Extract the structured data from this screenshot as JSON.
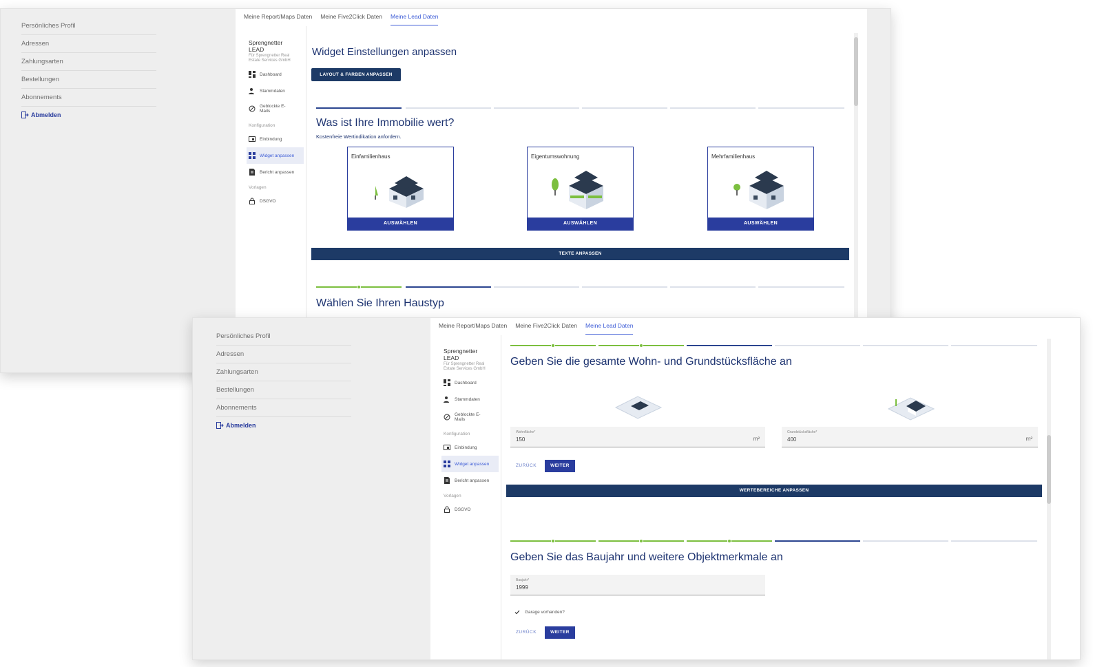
{
  "outer_sidebar": {
    "items": [
      "Persönliches Profil",
      "Adressen",
      "Zahlungsarten",
      "Bestellungen",
      "Abonnements"
    ],
    "logout": "Abmelden"
  },
  "tabs": [
    "Meine Report/Maps Daten",
    "Meine Five2Click Daten",
    "Meine Lead Daten"
  ],
  "inner_nav": {
    "brand": "Sprengnetter LEAD",
    "brand_sub": "Für Sprengnetter Real Estate Services GmbH",
    "dashboard": "Dashboard",
    "stammdaten": "Stammdaten",
    "blocked": "Geblockte E-Mails",
    "section_config": "Konfiguration",
    "einbindung": "Einbindung",
    "widget": "Widget anpassen",
    "bericht": "Bericht anpassen",
    "section_vorlagen": "Vorlagen",
    "dsgvo": "DSGVO"
  },
  "win1": {
    "title": "Widget Einstellungen anpassen",
    "layout_button": "LAYOUT & FARBEN ANPASSEN",
    "question": "Was ist Ihre Immobilie wert?",
    "subline": "Kostenfreie Wertindikation anfordern.",
    "cards": [
      {
        "label": "Einfamilienhaus",
        "button": "AUSWÄHLEN"
      },
      {
        "label": "Eigentumswohnung",
        "button": "AUSWÄHLEN"
      },
      {
        "label": "Mehrfamilienhaus",
        "button": "AUSWÄHLEN"
      }
    ],
    "texte_button": "TEXTE ANPASSEN",
    "question2": "Wählen Sie Ihren Haustyp"
  },
  "win2": {
    "question1": "Geben Sie die gesamte Wohn- und Grundstücksfläche an",
    "wohnflaeche_label": "Wohnfläche*",
    "wohnflaeche_value": "150",
    "grundstueck_label": "Grundstücksfläche*",
    "grundstueck_value": "400",
    "unit": "m²",
    "back": "ZURÜCK",
    "next": "WEITER",
    "wertebereiche_button": "WERTEBEREICHE ANPASSEN",
    "question2": "Geben Sie das Baujahr und weitere Objektmerkmale an",
    "baujahr_label": "Baujahr*",
    "baujahr_value": "1999",
    "garage": "Garage vorhanden?"
  },
  "colors": {
    "primary": "#2a3d9e",
    "dark": "#1d3a66",
    "done": "#7cbf3f"
  }
}
